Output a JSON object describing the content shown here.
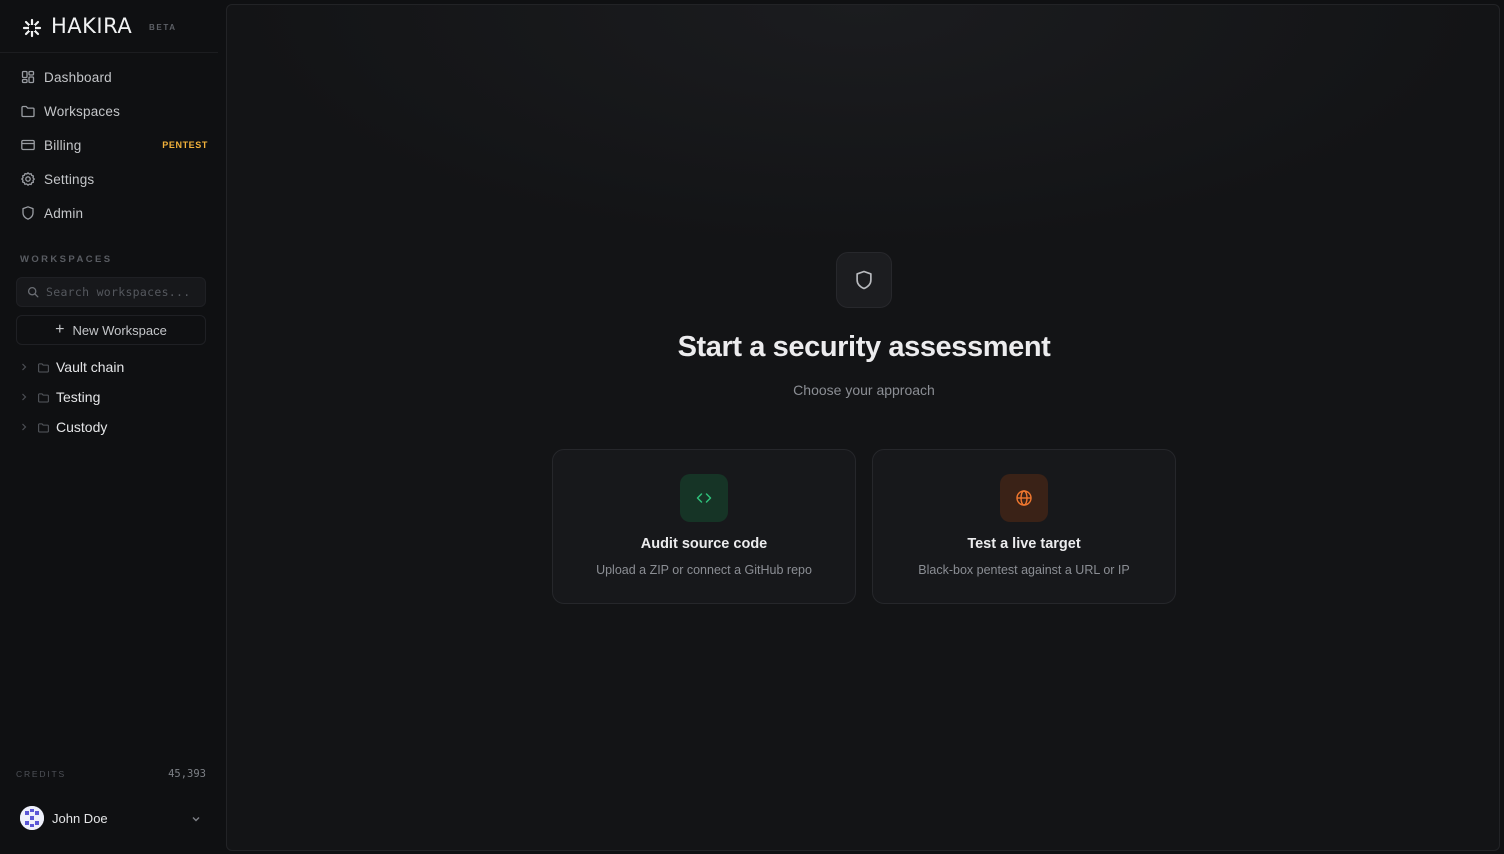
{
  "brand": {
    "name": "HAKIRA",
    "tag": "BETA"
  },
  "nav": {
    "items": [
      {
        "label": "Dashboard",
        "icon": "grid-icon"
      },
      {
        "label": "Workspaces",
        "icon": "folder-icon"
      },
      {
        "label": "Billing",
        "icon": "credit-card-icon",
        "badge": "PENTEST"
      },
      {
        "label": "Settings",
        "icon": "gear-icon"
      },
      {
        "label": "Admin",
        "icon": "shield-icon"
      }
    ]
  },
  "workspaces": {
    "section_label": "WORKSPACES",
    "search_placeholder": "Search workspaces...",
    "new_label": "New Workspace",
    "items": [
      "Vault chain",
      "Testing",
      "Custody"
    ]
  },
  "credits": {
    "label": "CREDITS",
    "value": "45,393"
  },
  "user": {
    "name": "John Doe"
  },
  "hero": {
    "title": "Start a security assessment",
    "subtitle": "Choose your approach"
  },
  "cards": [
    {
      "title": "Audit source code",
      "description": "Upload a ZIP or connect a GitHub repo",
      "icon": "code-icon",
      "accent": "#2fbf7a"
    },
    {
      "title": "Test a live target",
      "description": "Black-box pentest against a URL or IP",
      "icon": "globe-icon",
      "accent": "#f0772f"
    }
  ],
  "colors": {
    "badge": "#f3b23b",
    "code_accent": "#2fbf7a",
    "globe_accent": "#f0772f"
  }
}
